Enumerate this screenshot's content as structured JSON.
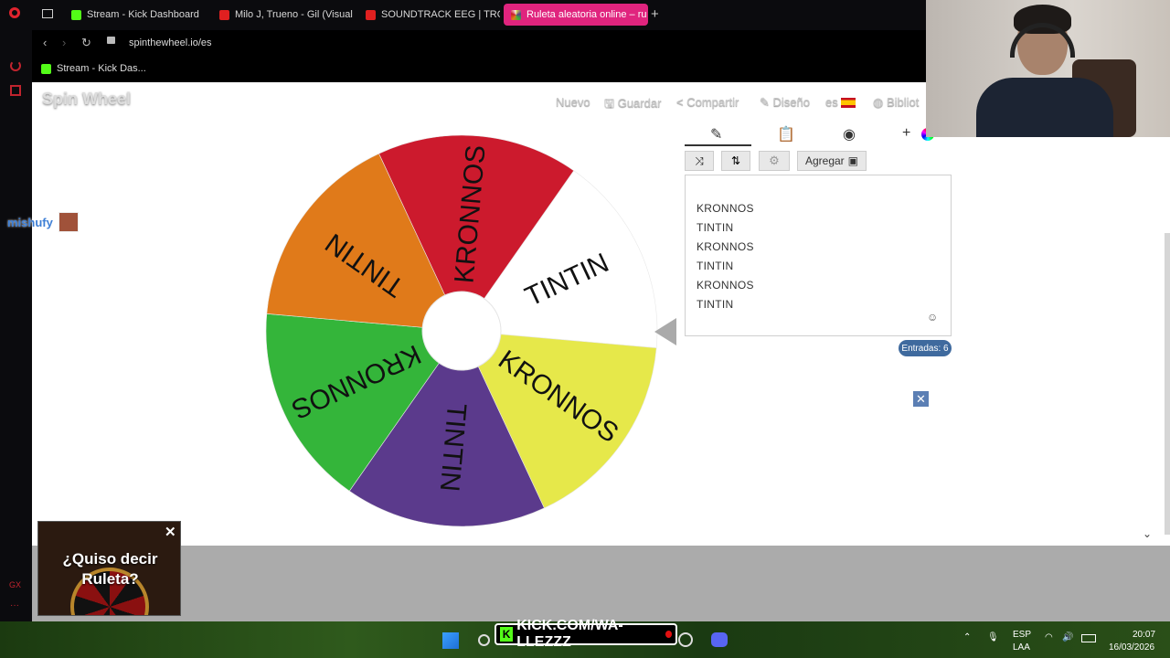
{
  "browser": {
    "tabs": [
      {
        "title": "Stream - Kick Dashboard",
        "color": "#53fc18"
      },
      {
        "title": "Milo J, Trueno - Gil (Visual",
        "color": "#e02020"
      },
      {
        "title": "SOUNDTRACK EEG | TRO",
        "color": "#e02020"
      },
      {
        "title": "Ruleta aleatoria online – ru",
        "color": "#ffffff"
      }
    ],
    "url": "spinthewheel.io/es",
    "bookmark": "Stream - Kick Das..."
  },
  "site": {
    "logo": "Spin Wheel",
    "nav": {
      "nuevo": "Nuevo",
      "guardar": "Guardar",
      "compartir": "Compartir",
      "diseno": "Diseño",
      "lang": "es",
      "biblio": "Bibliot"
    },
    "add_button": "Agregar",
    "entries": [
      "KRONNOS",
      "TINTIN",
      "KRONNOS",
      "TINTIN",
      "KRONNOS",
      "TINTIN"
    ],
    "entry_count_label": "Entradas: 6"
  },
  "wheel": {
    "segments": [
      {
        "label": "TINTIN",
        "color": "#ffffff"
      },
      {
        "label": "KRONNOS",
        "color": "#e6e84a"
      },
      {
        "label": "TINTIN",
        "color": "#5b3a8c"
      },
      {
        "label": "KRONNOS",
        "color": "#34b53a"
      },
      {
        "label": "TINTIN",
        "color": "#e07a1a"
      },
      {
        "label": "KRONNOS",
        "color": "#cc1a2d"
      }
    ]
  },
  "chat": {
    "user": "mishufy"
  },
  "ad": {
    "text": "¿Quiso decir Ruleta?"
  },
  "stream": {
    "banner": "KICK.COM/WA-LLEZZZ"
  },
  "tray": {
    "lang_top": "ESP",
    "lang_bottom": "LAA",
    "time": "20:07",
    "date": "16/03/2026"
  }
}
